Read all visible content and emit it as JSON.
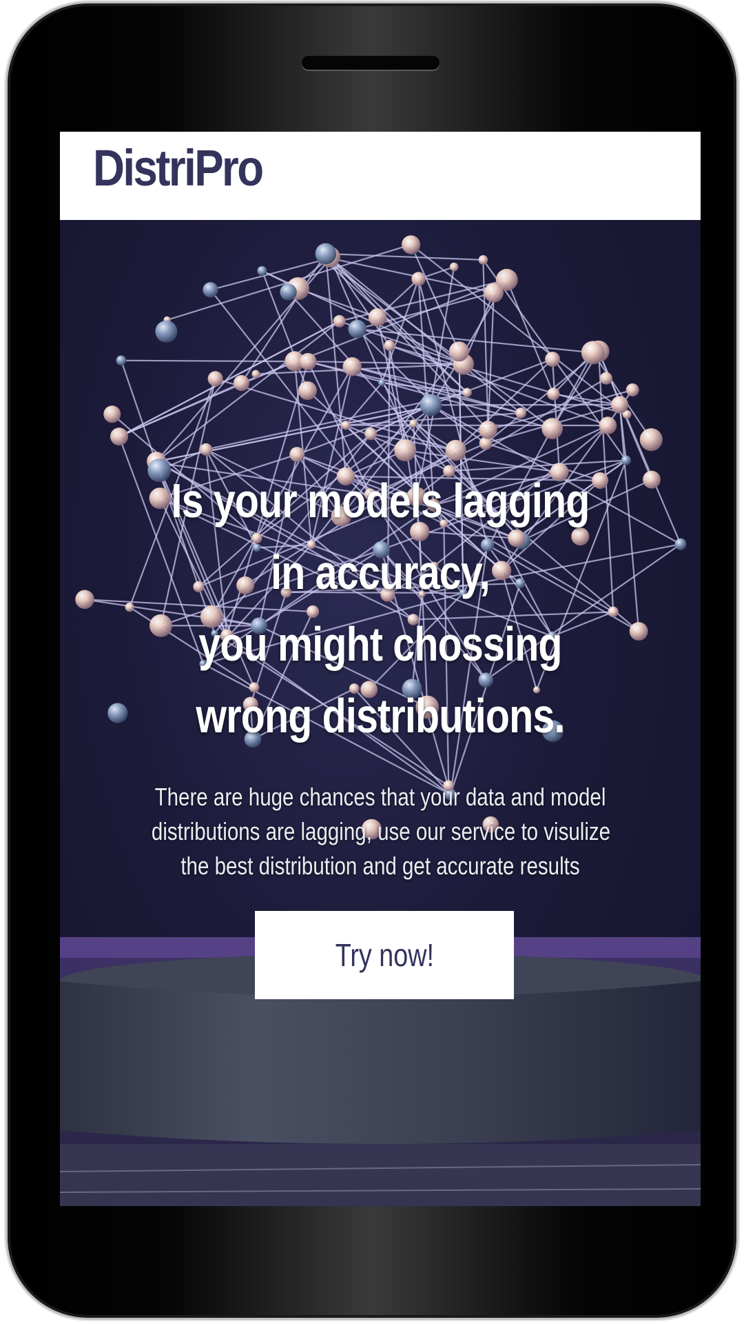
{
  "brand": {
    "name": "DistriPro",
    "color": "#34335c"
  },
  "hero": {
    "headline_lines": [
      "Is your models lagging",
      "in accuracy,",
      "you might chossing",
      "wrong distributions."
    ],
    "subtext_lines": [
      "There are huge chances that your data and model",
      "distributions are lagging, use our service to visulize",
      "the best distribution and get accurate results"
    ],
    "cta_label": "Try now!",
    "background_color": "#1b1a35"
  },
  "device": {
    "frame": "smartphone",
    "speaker_icon": "speaker-slot"
  }
}
